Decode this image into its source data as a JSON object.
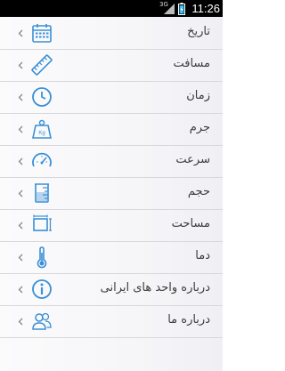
{
  "status_bar": {
    "network": "3G",
    "time": "11:26"
  },
  "menu": {
    "items": [
      {
        "label": "تاریخ",
        "icon": "calendar-icon"
      },
      {
        "label": "مسافت",
        "icon": "ruler-icon"
      },
      {
        "label": "زمان",
        "icon": "clock-icon"
      },
      {
        "label": "جرم",
        "icon": "weight-icon"
      },
      {
        "label": "سرعت",
        "icon": "speedometer-icon"
      },
      {
        "label": "حجم",
        "icon": "beaker-icon"
      },
      {
        "label": "مساحت",
        "icon": "area-icon"
      },
      {
        "label": "دما",
        "icon": "thermometer-icon"
      },
      {
        "label": "درباره واحد های ایرانی",
        "icon": "info-icon"
      },
      {
        "label": "درباره ما",
        "icon": "users-icon"
      }
    ]
  },
  "colors": {
    "icon": "#3a8fd6",
    "status_bar": "#000000",
    "label": "#3c3c3c",
    "divider": "#d8d8dc"
  }
}
